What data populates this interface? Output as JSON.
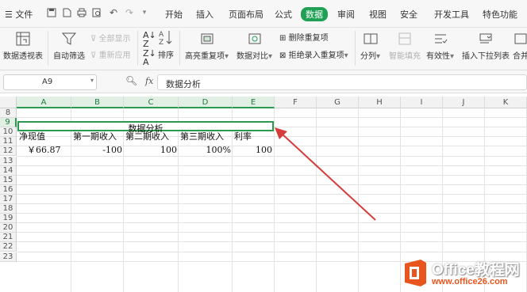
{
  "menubar": {
    "file_label": "文件",
    "tabs": [
      {
        "label": "开始"
      },
      {
        "label": "插入"
      },
      {
        "label": "页面布局"
      },
      {
        "label": "公式"
      },
      {
        "label": "数据"
      },
      {
        "label": "审阅"
      },
      {
        "label": "视图"
      },
      {
        "label": "安全"
      },
      {
        "label": "开发工具"
      },
      {
        "label": "特色功能"
      }
    ]
  },
  "ribbon": {
    "pivot": "数据透视表",
    "autofilter": "自动筛选",
    "show_all": "全部显示",
    "reapply": "重新应用",
    "sort": "排序",
    "highlight_dup": "高亮重复项",
    "data_compare": "数据对比",
    "remove_dup": "删除重复项",
    "reject_dup": "拒绝录入重复项",
    "split": "分列",
    "smart_fill": "智能填充",
    "validity": "有效性",
    "dropdown_list": "插入下拉列表",
    "merge": "合并"
  },
  "formula_bar": {
    "cell_ref": "A9",
    "fx": "fx",
    "content": "数据分析"
  },
  "sheet": {
    "columns": [
      "A",
      "B",
      "C",
      "D",
      "E",
      "F",
      "G",
      "H",
      "I",
      "J",
      "K"
    ],
    "rows": [
      "8",
      "9",
      "10",
      "11",
      "12",
      "13",
      "14",
      "15",
      "16",
      "17",
      "18",
      "19",
      "20",
      "21",
      "22",
      "23"
    ],
    "merged_title": "数据分析",
    "headers": [
      "净现值",
      "第一期收入",
      "第二期收入",
      "第三期收入",
      "利率"
    ],
    "values": [
      "￥66.87",
      "-100",
      "100",
      "100%",
      "100"
    ]
  },
  "watermark": {
    "brand": "Office教程网",
    "url": "www.office26.com"
  },
  "colors": {
    "accent": "#1fa055",
    "selection": "#2b9a4e",
    "arrow": "#d63c3c",
    "logo_orange": "#e8561e"
  }
}
